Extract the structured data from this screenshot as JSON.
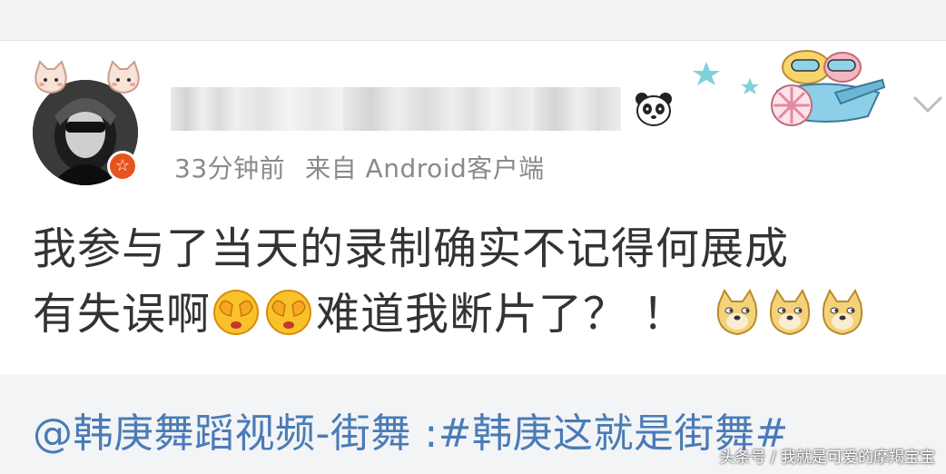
{
  "post": {
    "time": "33分钟前",
    "source": "来自 Android客户端",
    "content_line1": "我参与了当天的录制确实不记得何展成",
    "content_line2_a": "有失误啊",
    "content_line2_b": "难道我断片了？ ！"
  },
  "repost": {
    "text": "@韩庚舞蹈视频-街舞 :#韩庚这就是街舞#"
  },
  "watermark": {
    "text": "头条号 / 我就是可爱的摩羯宝宝"
  },
  "icons": [
    "cat-icon",
    "vip-badge-icon",
    "panda-icon",
    "airplane-sticker",
    "chevron-down-icon",
    "covering-eyes-emoji",
    "doge-emoji"
  ],
  "colors": {
    "link": "#4a7bb7",
    "text": "#333333",
    "meta": "#8a8a8a",
    "badge": "#e8541e",
    "repost_bg": "#f3f4f6"
  }
}
